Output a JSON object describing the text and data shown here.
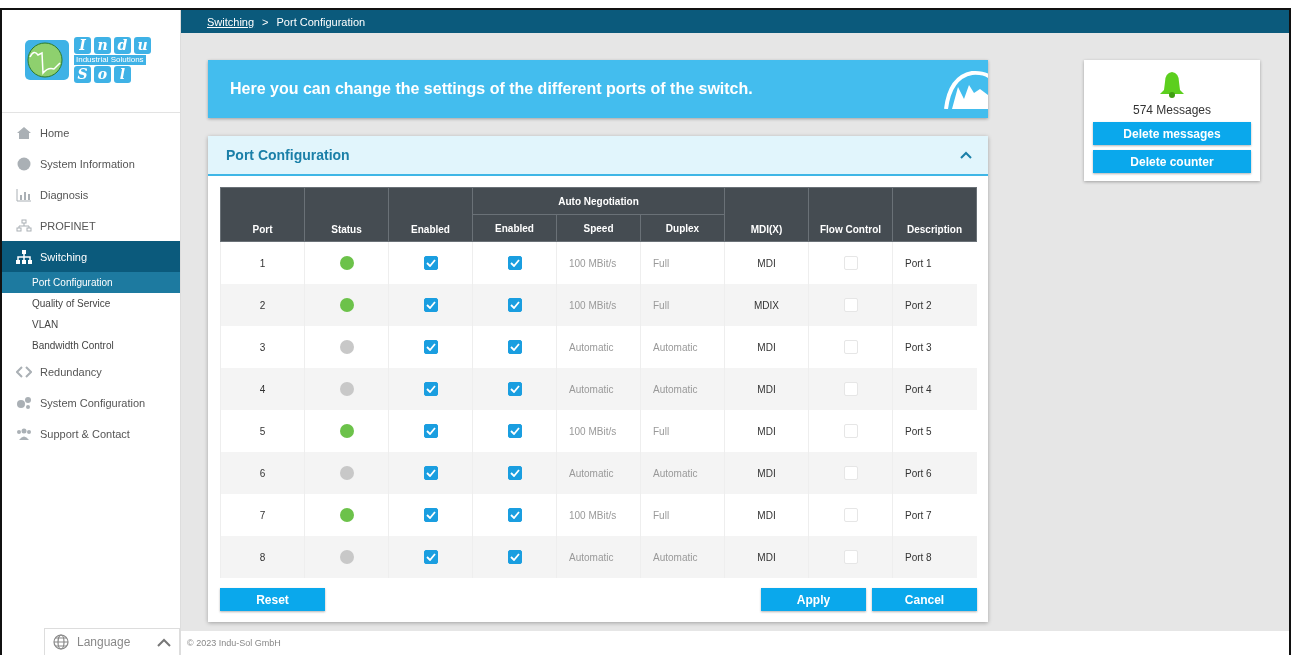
{
  "breadcrumb": {
    "link": "Switching",
    "separator": ">",
    "current": "Port Configuration"
  },
  "logo": {
    "top": [
      "I",
      "n",
      "d",
      "u"
    ],
    "tagline": "Industrial Solutions",
    "bottom": [
      "S",
      "o",
      "l"
    ]
  },
  "sidebar": {
    "items": [
      {
        "label": "Home",
        "selected": false
      },
      {
        "label": "System Information",
        "selected": false
      },
      {
        "label": "Diagnosis",
        "selected": false
      },
      {
        "label": "PROFINET",
        "selected": false
      },
      {
        "label": "Switching",
        "selected": true,
        "children": [
          {
            "label": "Port Configuration",
            "selected": true
          },
          {
            "label": "Quality of Service",
            "selected": false
          },
          {
            "label": "VLAN",
            "selected": false
          },
          {
            "label": "Bandwidth Control",
            "selected": false
          }
        ]
      },
      {
        "label": "Redundancy",
        "selected": false
      },
      {
        "label": "System Configuration",
        "selected": false
      },
      {
        "label": "Support & Contact",
        "selected": false
      }
    ]
  },
  "language": {
    "label": "Language",
    "expanded": false
  },
  "banner": {
    "text": "Here you can change the settings of the different ports of the switch."
  },
  "panel": {
    "title": "Port Configuration",
    "expanded": true
  },
  "table": {
    "group_header": "Auto Negotiation",
    "columns": [
      "Port",
      "Status",
      "Enabled",
      "Enabled",
      "Speed",
      "Duplex",
      "MDI(X)",
      "Flow Control",
      "Description"
    ],
    "rows": [
      {
        "port": "1",
        "color": "#6cc24a",
        "enabled": true,
        "auto_enabled": true,
        "speed": "100 MBit/s",
        "duplex": "Full",
        "mdi": "MDI",
        "flow_control": false,
        "description": "Port 1"
      },
      {
        "port": "2",
        "color": "#6cc24a",
        "enabled": true,
        "auto_enabled": true,
        "speed": "100 MBit/s",
        "duplex": "Full",
        "mdi": "MDIX",
        "flow_control": false,
        "description": "Port 2"
      },
      {
        "port": "3",
        "color": "#c8c8c8",
        "enabled": true,
        "auto_enabled": true,
        "speed": "Automatic",
        "duplex": "Automatic",
        "mdi": "MDI",
        "flow_control": false,
        "description": "Port 3"
      },
      {
        "port": "4",
        "color": "#c8c8c8",
        "enabled": true,
        "auto_enabled": true,
        "speed": "Automatic",
        "duplex": "Automatic",
        "mdi": "MDI",
        "flow_control": false,
        "description": "Port 4"
      },
      {
        "port": "5",
        "color": "#6cc24a",
        "enabled": true,
        "auto_enabled": true,
        "speed": "100 MBit/s",
        "duplex": "Full",
        "mdi": "MDI",
        "flow_control": false,
        "description": "Port 5"
      },
      {
        "port": "6",
        "color": "#c8c8c8",
        "enabled": true,
        "auto_enabled": true,
        "speed": "Automatic",
        "duplex": "Automatic",
        "mdi": "MDI",
        "flow_control": false,
        "description": "Port 6"
      },
      {
        "port": "7",
        "color": "#6cc24a",
        "enabled": true,
        "auto_enabled": true,
        "speed": "100 MBit/s",
        "duplex": "Full",
        "mdi": "MDI",
        "flow_control": false,
        "description": "Port 7"
      },
      {
        "port": "8",
        "color": "#c8c8c8",
        "enabled": true,
        "auto_enabled": true,
        "speed": "Automatic",
        "duplex": "Automatic",
        "mdi": "MDI",
        "flow_control": false,
        "description": "Port 8"
      }
    ]
  },
  "buttons": {
    "reset": "Reset",
    "apply": "Apply",
    "cancel": "Cancel"
  },
  "messages": {
    "count": "574 Messages",
    "delete_messages": "Delete messages",
    "delete_counter": "Delete counter"
  },
  "footer": {
    "copyright": "© 2023 Indu-Sol GmbH"
  }
}
